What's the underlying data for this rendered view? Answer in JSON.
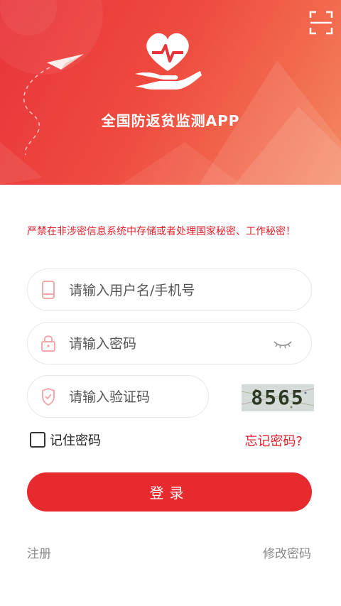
{
  "app": {
    "title": "全国防返贫监测APP"
  },
  "notice": {
    "warning": "严禁在非涉密信息系统中存储或者处理国家秘密、工作秘密！"
  },
  "form": {
    "username_placeholder": "请输入用户名/手机号",
    "password_placeholder": "请输入密码",
    "captcha_placeholder": "请输入验证码",
    "captcha_value": "8565",
    "remember_label": "记住密码",
    "forgot_label": "忘记密码?",
    "login_label": "登录"
  },
  "footer": {
    "register_label": "注册",
    "change_password_label": "修改密码"
  },
  "colors": {
    "brand_red": "#e72a2e",
    "warning_red": "#e0202a"
  },
  "icons": [
    "scan-icon",
    "heart-hand-logo-icon",
    "paper-plane-icon",
    "phone-icon",
    "lock-icon",
    "shield-icon",
    "eye-closed-icon"
  ]
}
